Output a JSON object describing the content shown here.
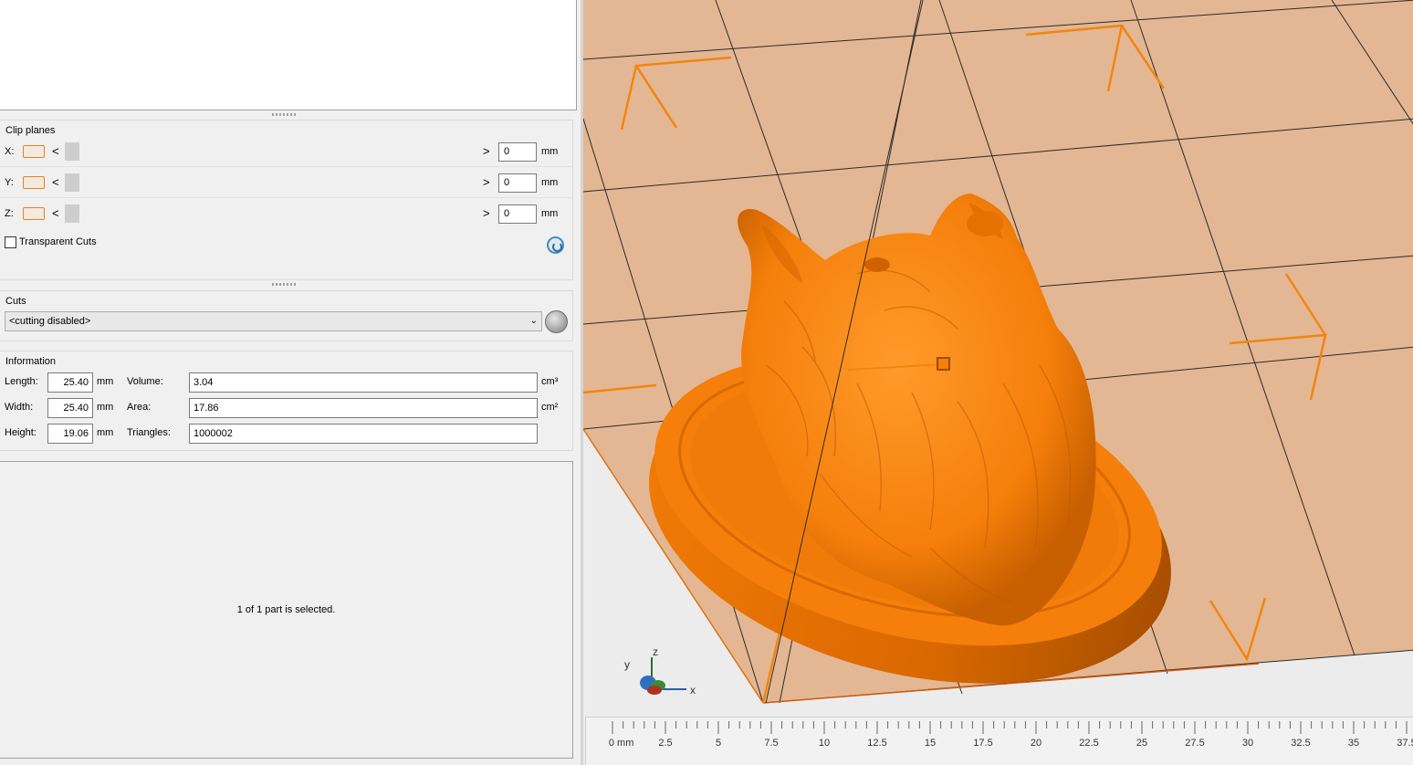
{
  "clip_planes": {
    "title": "Clip planes",
    "rows": [
      {
        "axis": "X:",
        "value": "0",
        "unit": "mm"
      },
      {
        "axis": "Y:",
        "value": "0",
        "unit": "mm"
      },
      {
        "axis": "Z:",
        "value": "0",
        "unit": "mm"
      }
    ],
    "arrow_left": "<",
    "arrow_right": ">",
    "transparent_cuts_label": "Transparent Cuts",
    "transparent_cuts_checked": false
  },
  "cuts": {
    "title": "Cuts",
    "selected": "<cutting disabled>"
  },
  "information": {
    "title": "Information",
    "length_label": "Length:",
    "length_value": "25.40",
    "length_unit": "mm",
    "width_label": "Width:",
    "width_value": "25.40",
    "width_unit": "mm",
    "height_label": "Height:",
    "height_value": "19.06",
    "height_unit": "mm",
    "volume_label": "Volume:",
    "volume_value": "3.04",
    "volume_unit": "cm³",
    "area_label": "Area:",
    "area_value": "17.86",
    "area_unit": "cm²",
    "triangles_label": "Triangles:",
    "triangles_value": "1000002"
  },
  "status": "1 of 1 part is selected.",
  "viewport": {
    "axis_x": "x",
    "axis_y": "y",
    "axis_z": "z",
    "model_color": "#f57f0a",
    "plate_color": "#e3b793"
  },
  "ruler": {
    "ticks": [
      "0 mm",
      "2.5",
      "5",
      "7.5",
      "10",
      "12.5",
      "15",
      "17.5",
      "20",
      "22.5",
      "25",
      "27.5",
      "30",
      "32.5",
      "35",
      "37.5"
    ]
  }
}
